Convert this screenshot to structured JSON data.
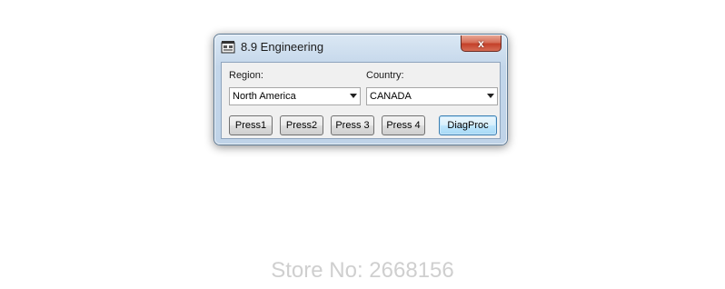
{
  "window": {
    "title": "8.9 Engineering",
    "close_glyph": "x",
    "icon": "app-icon"
  },
  "form": {
    "region_label": "Region:",
    "region_value": "North America",
    "country_label": "Country:",
    "country_value": "CANADA"
  },
  "buttons": {
    "press1": "Press1",
    "press2": "Press2",
    "press3": "Press 3",
    "press4": "Press 4",
    "diagproc": "DiagProc"
  },
  "watermark": "Store No: 2668156",
  "colors": {
    "close_button": "#c4402a",
    "default_button_border": "#3c7fb1",
    "watermark": "#cfcfcf"
  }
}
